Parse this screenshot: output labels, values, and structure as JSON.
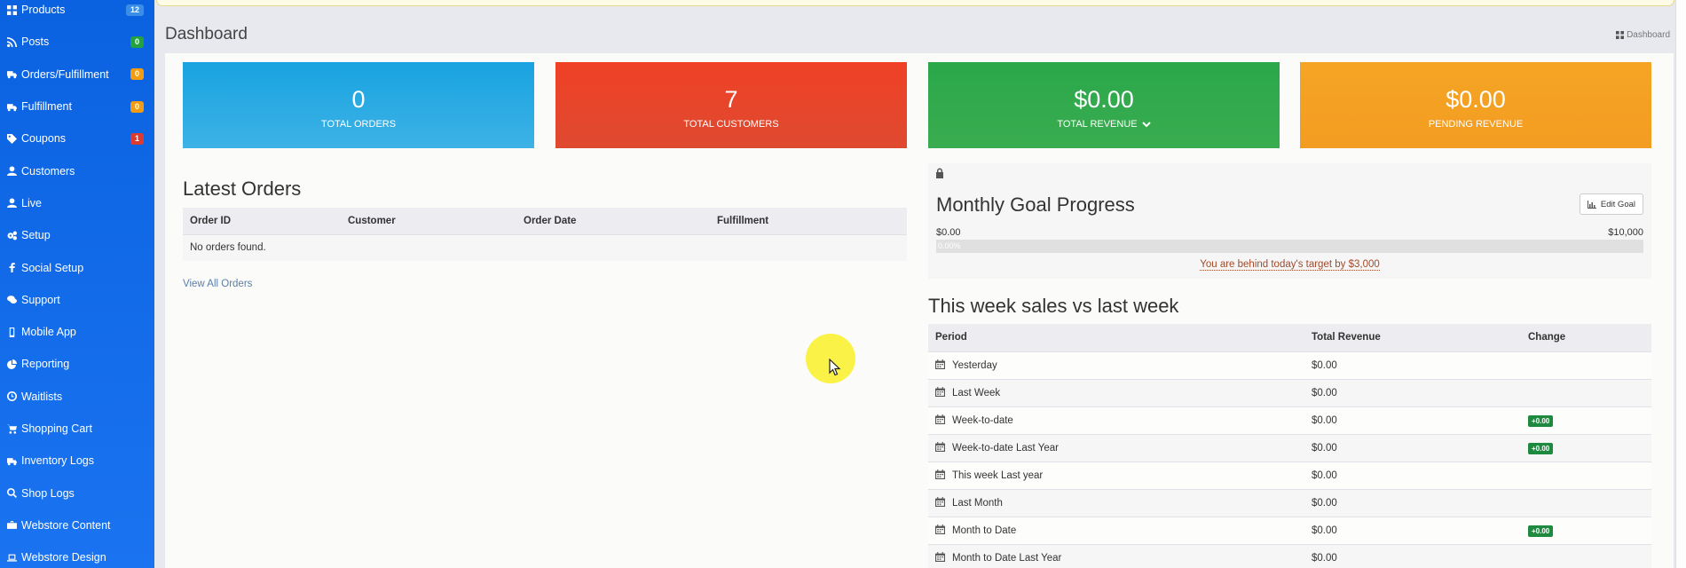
{
  "sidebar": {
    "items": [
      {
        "label": "Products",
        "icon": "grid-icon",
        "badge": "12",
        "badge_color": "#3a8ee6"
      },
      {
        "label": "Posts",
        "icon": "rss-icon",
        "badge": "0",
        "badge_color": "#22a340"
      },
      {
        "label": "Orders/Fulfillment",
        "icon": "truck-icon",
        "badge": "0",
        "badge_color": "#f39c12"
      },
      {
        "label": "Fulfillment",
        "icon": "truck-icon",
        "badge": "0",
        "badge_color": "#f39c12"
      },
      {
        "label": "Coupons",
        "icon": "tag-icon",
        "badge": "1",
        "badge_color": "#dd3b2f"
      },
      {
        "label": "Customers",
        "icon": "user-icon"
      },
      {
        "label": "Live",
        "icon": "user-icon"
      },
      {
        "label": "Setup",
        "icon": "gears-icon"
      },
      {
        "label": "Social Setup",
        "icon": "facebook-icon"
      },
      {
        "label": "Support",
        "icon": "chat-icon"
      },
      {
        "label": "Mobile App",
        "icon": "mobile-icon"
      },
      {
        "label": "Reporting",
        "icon": "pie-chart-icon"
      },
      {
        "label": "Waitlists",
        "icon": "clock-icon"
      },
      {
        "label": "Shopping Cart",
        "icon": "cart-icon"
      },
      {
        "label": "Inventory Logs",
        "icon": "truck-icon"
      },
      {
        "label": "Shop Logs",
        "icon": "search-icon"
      },
      {
        "label": "Webstore Content",
        "icon": "briefcase-icon"
      },
      {
        "label": "Webstore Design",
        "icon": "laptop-icon"
      }
    ]
  },
  "header": {
    "title": "Dashboard",
    "breadcrumb": "Dashboard"
  },
  "stats": [
    {
      "value": "0",
      "label": "TOTAL ORDERS",
      "color": "#19a3e0"
    },
    {
      "value": "7",
      "label": "TOTAL CUSTOMERS",
      "color": "#f04126"
    },
    {
      "value": "$0.00",
      "label": "TOTAL REVENUE",
      "color": "#2aa84a"
    },
    {
      "value": "$0.00",
      "label": "PENDING REVENUE",
      "color": "#f5a524"
    }
  ],
  "orders": {
    "title": "Latest Orders",
    "columns": [
      "Order ID",
      "Customer",
      "Order Date",
      "Fulfillment"
    ],
    "empty_text": "No orders found.",
    "view_all": "View All Orders"
  },
  "goal": {
    "title": "Monthly Goal Progress",
    "edit_label": "Edit Goal",
    "min_label": "$0.00",
    "max_label": "$10,000",
    "progress_label": "0.00%",
    "progress_fraction": 0,
    "behind_text": "You are behind today's target by $3,000"
  },
  "sales": {
    "title": "This week sales vs last week",
    "columns": [
      "Period",
      "Total Revenue",
      "Change"
    ],
    "rows": [
      {
        "period": "Yesterday",
        "revenue": "$0.00",
        "change": ""
      },
      {
        "period": "Last Week",
        "revenue": "$0.00",
        "change": ""
      },
      {
        "period": "Week-to-date",
        "revenue": "$0.00",
        "change": "+0.00"
      },
      {
        "period": "Week-to-date Last Year",
        "revenue": "$0.00",
        "change": "+0.00"
      },
      {
        "period": "This week Last year",
        "revenue": "$0.00",
        "change": ""
      },
      {
        "period": "Last Month",
        "revenue": "$0.00",
        "change": ""
      },
      {
        "period": "Month to Date",
        "revenue": "$0.00",
        "change": "+0.00"
      },
      {
        "period": "Month to Date Last Year",
        "revenue": "$0.00",
        "change": ""
      }
    ]
  }
}
